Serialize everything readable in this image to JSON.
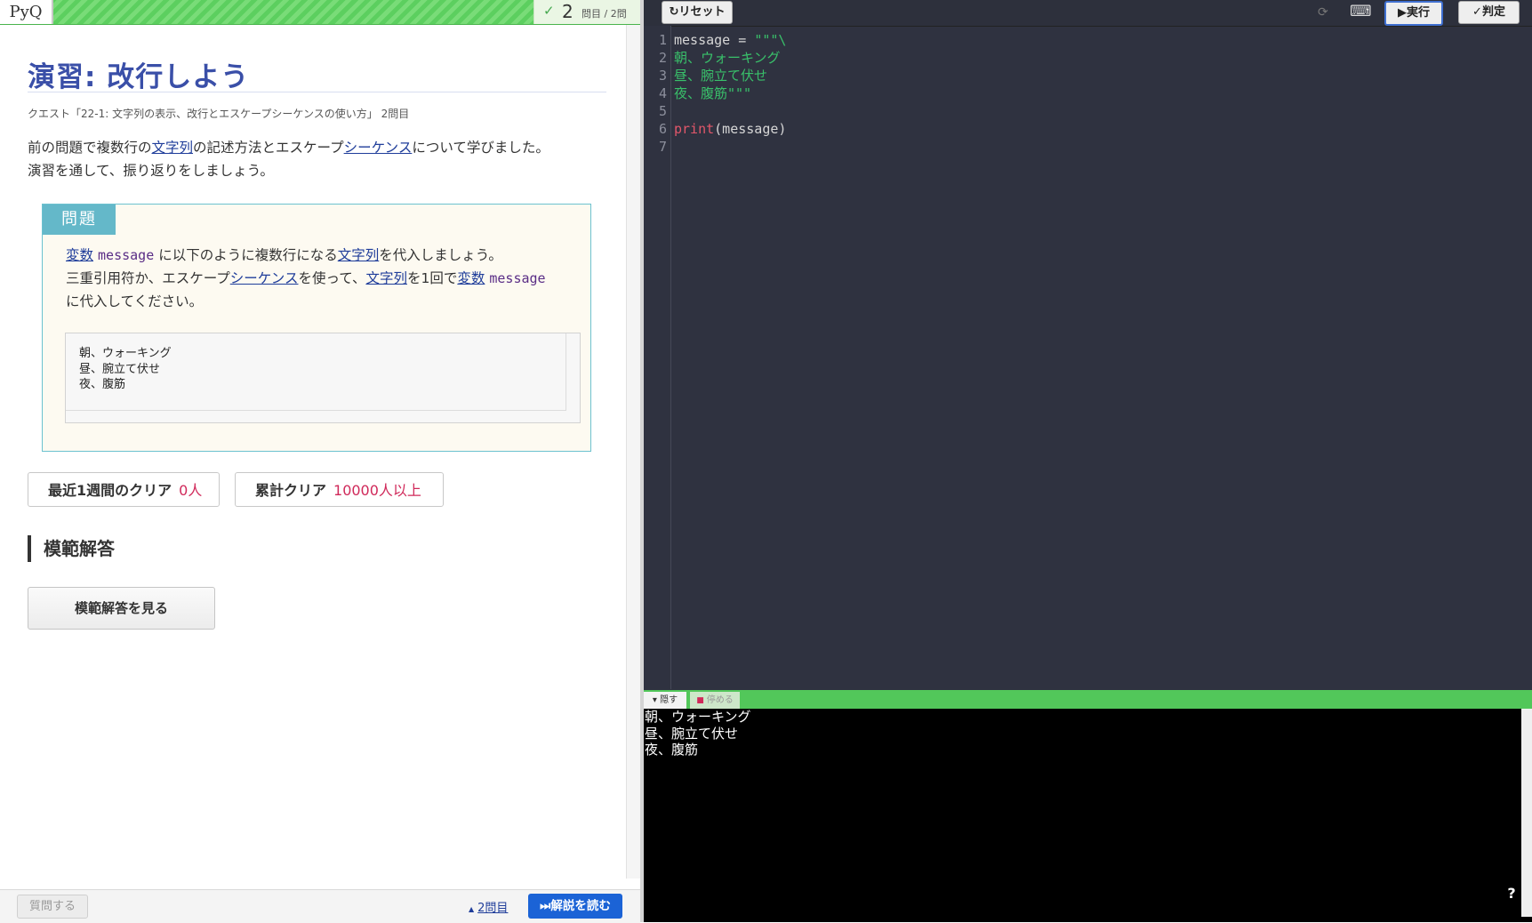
{
  "header": {
    "logo": "PyQ",
    "progress_check": "✓",
    "progress_number": "2",
    "progress_total": "問目 / 2問"
  },
  "main": {
    "title": "演習: 改行しよう",
    "quest": "クエスト「22-1: 文字列の表示、改行とエスケープシーケンスの使い方」 2問目",
    "intro": [
      {
        "text": "前の問題で複数行の",
        "link": false
      },
      {
        "text": "文字列",
        "link": true
      },
      {
        "text": "の記述方法とエスケープ",
        "link": false
      },
      {
        "text": "シーケンス",
        "link": true
      },
      {
        "text": "について学びました。",
        "link": false
      },
      {
        "text": "演習を通して、振り返りをしましょう。",
        "link": false
      }
    ]
  },
  "problem": {
    "tab_label": "問題",
    "line1": [
      {
        "text": "変数",
        "type": "link"
      },
      {
        "text": "message",
        "type": "code"
      },
      {
        "text": "に以下のように複数行になる",
        "type": "text"
      },
      {
        "text": "文字列",
        "type": "link"
      },
      {
        "text": "を代入しましょう。",
        "type": "text"
      }
    ],
    "line2": [
      {
        "text": "三重引用符か、エスケープ",
        "type": "text"
      },
      {
        "text": "シーケンス",
        "type": "link"
      },
      {
        "text": "を使って、",
        "type": "text"
      },
      {
        "text": "文字列",
        "type": "link"
      },
      {
        "text": "を1回で",
        "type": "text"
      },
      {
        "text": "変数",
        "type": "link"
      },
      {
        "text": "message",
        "type": "code"
      }
    ],
    "line3": "に代入してください。",
    "sample_lines": [
      "朝、ウォーキング",
      "昼、腕立て伏せ",
      "夜、腹筋"
    ]
  },
  "stats": {
    "weekly_label": "最近1週間のクリア",
    "weekly_value": "0人",
    "total_label": "累計クリア",
    "total_value": "10000人以上"
  },
  "answer": {
    "heading": "模範解答",
    "button_label": "模範解答を見る"
  },
  "footer": {
    "ask_label": "質問する",
    "prev_arrow": "▲",
    "prev_label": "2問目",
    "explain_label": "⏭解説を読む"
  },
  "editor": {
    "reset_label": "↻リセット",
    "run_label": "▶実行",
    "judge_label": "✓判定",
    "reload_icon": "⟳",
    "keyboard_icon": "⌨",
    "line_numbers": [
      "1",
      "2",
      "3",
      "4",
      "5",
      "6",
      "7"
    ],
    "code_lines": [
      [
        {
          "t": "message = ",
          "c": "plain"
        },
        {
          "t": "\"\"\"\\",
          "c": "str"
        }
      ],
      [
        {
          "t": "朝、ウォーキング",
          "c": "str"
        }
      ],
      [
        {
          "t": "昼、腕立て伏せ",
          "c": "str"
        }
      ],
      [
        {
          "t": "夜、腹筋\"\"\"",
          "c": "str"
        }
      ],
      [],
      [
        {
          "t": "print",
          "c": "kw"
        },
        {
          "t": "(message)",
          "c": "plain"
        }
      ],
      []
    ]
  },
  "console": {
    "hide_label": "▾ 隠す",
    "stop_label": "停める",
    "output": "朝、ウォーキング\n昼、腕立て伏せ\n夜、腹筋",
    "help_icon": "?"
  },
  "colors": {
    "title": "#3a4fa8",
    "link": "#1f3d9a",
    "accent_red": "#d0295a",
    "primary_button": "#1b63d6",
    "console_bar": "#52c75a",
    "code_string": "#39c06a",
    "code_keyword": "#e2576a"
  }
}
